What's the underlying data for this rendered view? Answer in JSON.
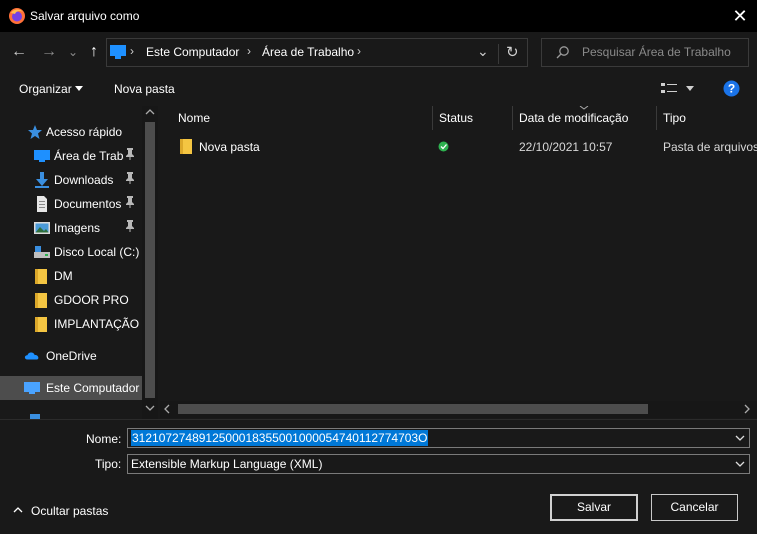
{
  "window": {
    "title": "Salvar arquivo como",
    "close_glyph": "✕"
  },
  "nav": {
    "back_glyph": "←",
    "forward_glyph": "→",
    "recent_glyph": "⌄",
    "up_glyph": "↑",
    "breadcrumb": [
      "Este Computador",
      "Área de Trabalho"
    ],
    "breadcrumb_sep": "›",
    "refresh_glyph": "↻",
    "dropdown_glyph": "⌄",
    "search_placeholder": "Pesquisar Área de Trabalho"
  },
  "toolbar": {
    "organize_label": "Organizar",
    "new_folder_label": "Nova pasta",
    "help_glyph": "?"
  },
  "sidebar": {
    "items": [
      {
        "label": "Acesso rápido",
        "icon": "star-icon",
        "pinned": false
      },
      {
        "label": "Área de Traba",
        "icon": "desktop-icon",
        "pinned": true
      },
      {
        "label": "Downloads",
        "icon": "download-icon",
        "pinned": true
      },
      {
        "label": "Documentos",
        "icon": "document-icon",
        "pinned": true
      },
      {
        "label": "Imagens",
        "icon": "image-icon",
        "pinned": true
      },
      {
        "label": "Disco Local (C:)",
        "icon": "drive-icon",
        "pinned": false
      },
      {
        "label": "DM",
        "icon": "folder-icon",
        "pinned": false
      },
      {
        "label": "GDOOR PRO",
        "icon": "folder-icon",
        "pinned": false
      },
      {
        "label": "IMPLANTAÇÃO",
        "icon": "folder-icon",
        "pinned": false
      },
      {
        "label": "OneDrive",
        "icon": "cloud-icon",
        "pinned": false
      },
      {
        "label": "Este Computador",
        "icon": "computer-icon",
        "pinned": false
      }
    ],
    "pin_glyph": "📌"
  },
  "files": {
    "columns": [
      "Nome",
      "Status",
      "Data de modificação",
      "Tipo"
    ],
    "rows": [
      {
        "name": "Nova pasta",
        "status": "synced",
        "modified": "22/10/2021 10:57",
        "type": "Pasta de arquivos"
      }
    ]
  },
  "form": {
    "name_label": "Nome:",
    "name_value": "3121072748912500018355001000054740112774703O",
    "type_label": "Tipo:",
    "type_value": "Extensible Markup Language (XML)"
  },
  "footer": {
    "hide_folders_label": "Ocultar pastas",
    "save_label": "Salvar",
    "cancel_label": "Cancelar"
  },
  "colors": {
    "accent": "#0078d7",
    "selection": "#0078d7",
    "folder": "#f4c542",
    "help": "#1a73e8",
    "status_ok": "#2db14f"
  }
}
